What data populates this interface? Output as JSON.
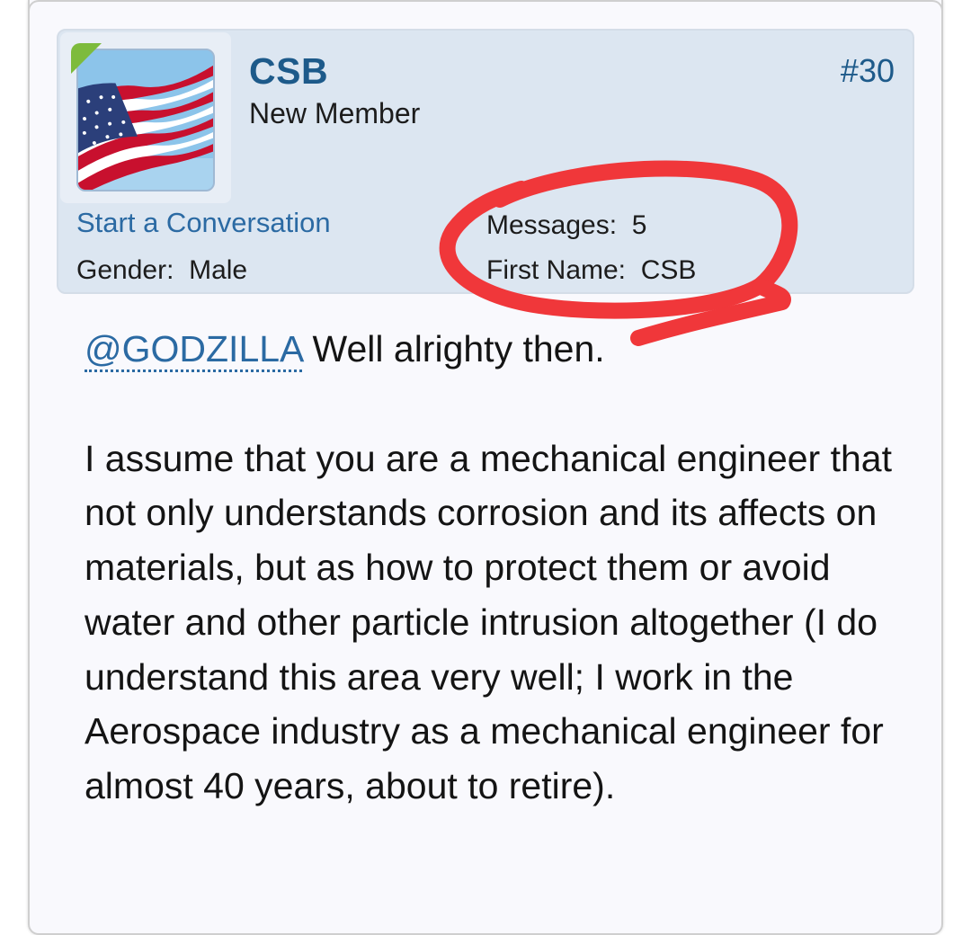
{
  "post": {
    "username": "CSB",
    "user_title": "New Member",
    "post_number": "#30",
    "start_conversation": "Start a Conversation",
    "gender_label": "Gender:",
    "gender_value": "Male",
    "messages_label": "Messages:",
    "messages_value": "5",
    "first_name_label": "First Name:",
    "first_name_value": "CSB",
    "avatar_icon": "us-flag-avatar",
    "online_indicator_color": "#7dbb3c",
    "annotation_color": "#f0373a"
  },
  "body": {
    "mention": "@GODZILLA",
    "first_line": " Well alrighty then.",
    "paragraph": "I assume that you are a mechanical engineer that not only understands corrosion and its affects on materials, but as how to protect them or avoid water and other particle intrusion altogether (I do understand this area very well; I work in the Aerospace industry as a mechanical engineer for almost 40 years, about to retire)."
  }
}
